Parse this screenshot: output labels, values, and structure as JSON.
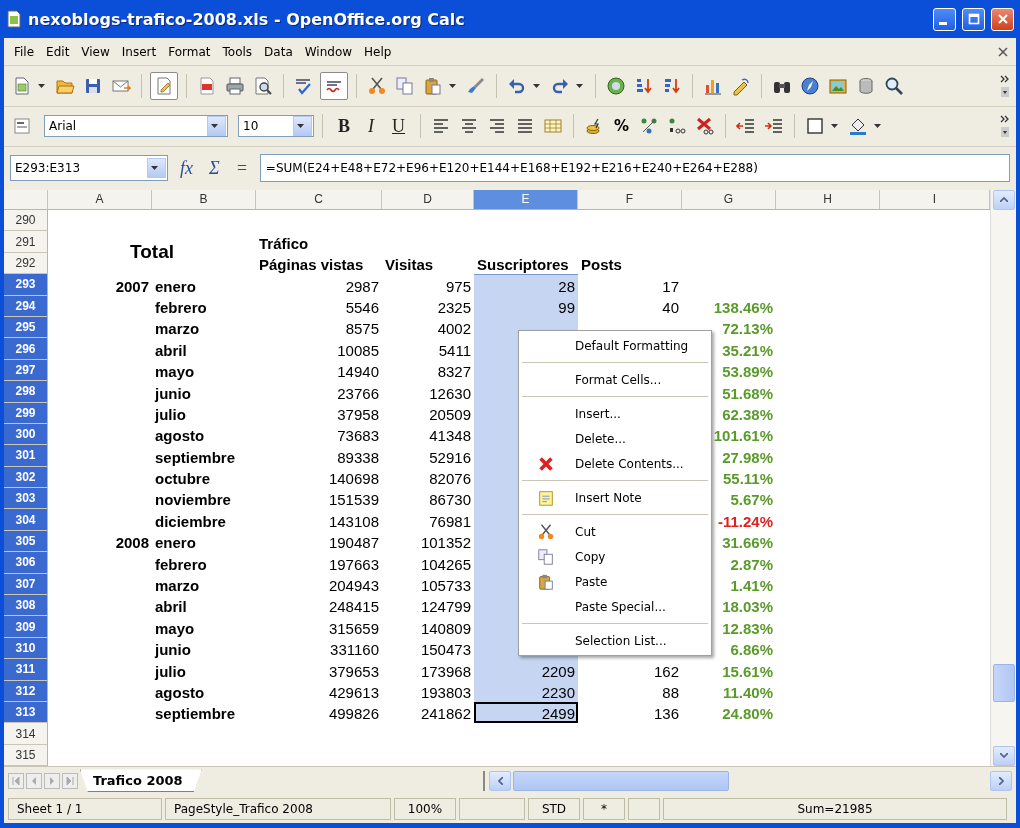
{
  "window": {
    "title": "nexoblogs-trafico-2008.xls - OpenOffice.org Calc"
  },
  "menu_bar": [
    "File",
    "Edit",
    "View",
    "Insert",
    "Format",
    "Tools",
    "Data",
    "Window",
    "Help"
  ],
  "standard_toolbar": {
    "edit_mode": true,
    "auto_spellcheck": true
  },
  "formatting_toolbar": {
    "font_name": "Arial",
    "font_size": "10",
    "text_style_buttons": [
      "B",
      "I",
      "U"
    ],
    "percent_button": "%"
  },
  "formula_bar": {
    "name_box": "E293:E313",
    "buttons": [
      "fx",
      "Σ",
      "="
    ],
    "formula": "=SUM(E24+E48+E72+E96+E120+E144+E168+E192+E216+E240+E264+E288)"
  },
  "sheet": {
    "columns": [
      {
        "label": "A",
        "selected": false
      },
      {
        "label": "B",
        "selected": false
      },
      {
        "label": "C",
        "selected": false
      },
      {
        "label": "D",
        "selected": false
      },
      {
        "label": "E",
        "selected": true
      },
      {
        "label": "F",
        "selected": false
      },
      {
        "label": "G",
        "selected": false
      },
      {
        "label": "H",
        "selected": false
      },
      {
        "label": "I",
        "selected": false
      }
    ],
    "rows": [
      {
        "number": "290",
        "selected": false,
        "kind": "blank"
      },
      {
        "number": "291",
        "selected": false,
        "kind": "title",
        "a": "Total",
        "c": "Tráfico"
      },
      {
        "number": "292",
        "selected": false,
        "kind": "heading",
        "c": "Páginas vistas",
        "d": "Visitas",
        "e": "Suscriptores",
        "f": "Posts"
      },
      {
        "number": "293",
        "selected": true,
        "kind": "data",
        "a": "2007",
        "b": "enero",
        "c": "2987",
        "d": "975",
        "e": "28",
        "f": "17"
      },
      {
        "number": "294",
        "selected": true,
        "kind": "data",
        "negative": false,
        "b": "febrero",
        "c": "5546",
        "d": "2325",
        "e": "99",
        "f": "40",
        "g": "138.46%"
      },
      {
        "number": "295",
        "selected": true,
        "kind": "data",
        "negative": false,
        "b": "marzo",
        "c": "8575",
        "d": "4002",
        "g": "72.13%"
      },
      {
        "number": "296",
        "selected": true,
        "kind": "data",
        "negative": false,
        "b": "abril",
        "c": "10085",
        "d": "5411",
        "g": "35.21%"
      },
      {
        "number": "297",
        "selected": true,
        "kind": "data",
        "negative": false,
        "b": "mayo",
        "c": "14940",
        "d": "8327",
        "g": "53.89%"
      },
      {
        "number": "298",
        "selected": true,
        "kind": "data",
        "negative": false,
        "b": "junio",
        "c": "23766",
        "d": "12630",
        "g": "51.68%"
      },
      {
        "number": "299",
        "selected": true,
        "kind": "data",
        "negative": false,
        "b": "julio",
        "c": "37958",
        "d": "20509",
        "g": "62.38%"
      },
      {
        "number": "300",
        "selected": true,
        "kind": "data",
        "negative": false,
        "b": "agosto",
        "c": "73683",
        "d": "41348",
        "g": "101.61%"
      },
      {
        "number": "301",
        "selected": true,
        "kind": "data",
        "negative": false,
        "b": "septiembre",
        "c": "89338",
        "d": "52916",
        "g": "27.98%"
      },
      {
        "number": "302",
        "selected": true,
        "kind": "data",
        "negative": false,
        "b": "octubre",
        "c": "140698",
        "d": "82076",
        "g": "55.11%"
      },
      {
        "number": "303",
        "selected": true,
        "kind": "data",
        "negative": false,
        "b": "noviembre",
        "c": "151539",
        "d": "86730",
        "g": "5.67%"
      },
      {
        "number": "304",
        "selected": true,
        "kind": "data",
        "negative": true,
        "b": "diciembre",
        "c": "143108",
        "d": "76981",
        "g": "-11.24%"
      },
      {
        "number": "305",
        "selected": true,
        "kind": "data",
        "negative": false,
        "a": "2008",
        "b": "enero",
        "c": "190487",
        "d": "101352",
        "g": "31.66%"
      },
      {
        "number": "306",
        "selected": true,
        "kind": "data",
        "negative": false,
        "b": "febrero",
        "c": "197663",
        "d": "104265",
        "g": "2.87%"
      },
      {
        "number": "307",
        "selected": true,
        "kind": "data",
        "negative": false,
        "b": "marzo",
        "c": "204943",
        "d": "105733",
        "g": "1.41%"
      },
      {
        "number": "308",
        "selected": true,
        "kind": "data",
        "negative": false,
        "b": "abril",
        "c": "248415",
        "d": "124799",
        "g": "18.03%"
      },
      {
        "number": "309",
        "selected": true,
        "kind": "data",
        "negative": false,
        "b": "mayo",
        "c": "315659",
        "d": "140809",
        "g": "12.83%"
      },
      {
        "number": "310",
        "selected": true,
        "kind": "data",
        "negative": false,
        "b": "junio",
        "c": "331160",
        "d": "150473",
        "g": "6.86%"
      },
      {
        "number": "311",
        "selected": true,
        "kind": "data",
        "negative": false,
        "b": "julio",
        "c": "379653",
        "d": "173968",
        "e": "2209",
        "f": "162",
        "g": "15.61%"
      },
      {
        "number": "312",
        "selected": true,
        "kind": "data",
        "negative": false,
        "b": "agosto",
        "c": "429613",
        "d": "193803",
        "e": "2230",
        "f": "88",
        "g": "11.40%"
      },
      {
        "number": "313",
        "selected": true,
        "kind": "data",
        "negative": false,
        "b": "septiembre",
        "c": "499826",
        "d": "241862",
        "e": "2499",
        "f": "136",
        "g": "24.80%"
      },
      {
        "number": "314",
        "selected": false,
        "kind": "blank"
      },
      {
        "number": "315",
        "selected": false,
        "kind": "blank"
      }
    ]
  },
  "context_menu": [
    {
      "kind": "item",
      "label": "Default Formatting"
    },
    {
      "kind": "separator"
    },
    {
      "kind": "item",
      "label": "Format Cells..."
    },
    {
      "kind": "separator"
    },
    {
      "kind": "item",
      "label": "Insert..."
    },
    {
      "kind": "item",
      "label": "Delete..."
    },
    {
      "kind": "item",
      "label": "Delete Contents..."
    },
    {
      "kind": "separator"
    },
    {
      "kind": "item",
      "label": "Insert Note"
    },
    {
      "kind": "separator"
    },
    {
      "kind": "item",
      "label": "Cut"
    },
    {
      "kind": "item",
      "label": "Copy"
    },
    {
      "kind": "item",
      "label": "Paste"
    },
    {
      "kind": "item",
      "label": "Paste Special..."
    },
    {
      "kind": "separator"
    },
    {
      "kind": "item",
      "label": "Selection List..."
    }
  ],
  "sheet_tabs": [
    {
      "label": "Trafico 2008",
      "selected": true
    }
  ],
  "status_bar": [
    {
      "kind": "text",
      "text": "Sheet 1 / 1"
    },
    {
      "kind": "text",
      "text": "PageStyle_Trafico 2008"
    },
    {
      "kind": "text",
      "text": "100%"
    },
    {
      "kind": "empty"
    },
    {
      "kind": "text",
      "text": "STD"
    },
    {
      "kind": "text",
      "text": "*"
    },
    {
      "kind": "empty"
    },
    {
      "kind": "text",
      "text": "Sum=21985"
    }
  ]
}
